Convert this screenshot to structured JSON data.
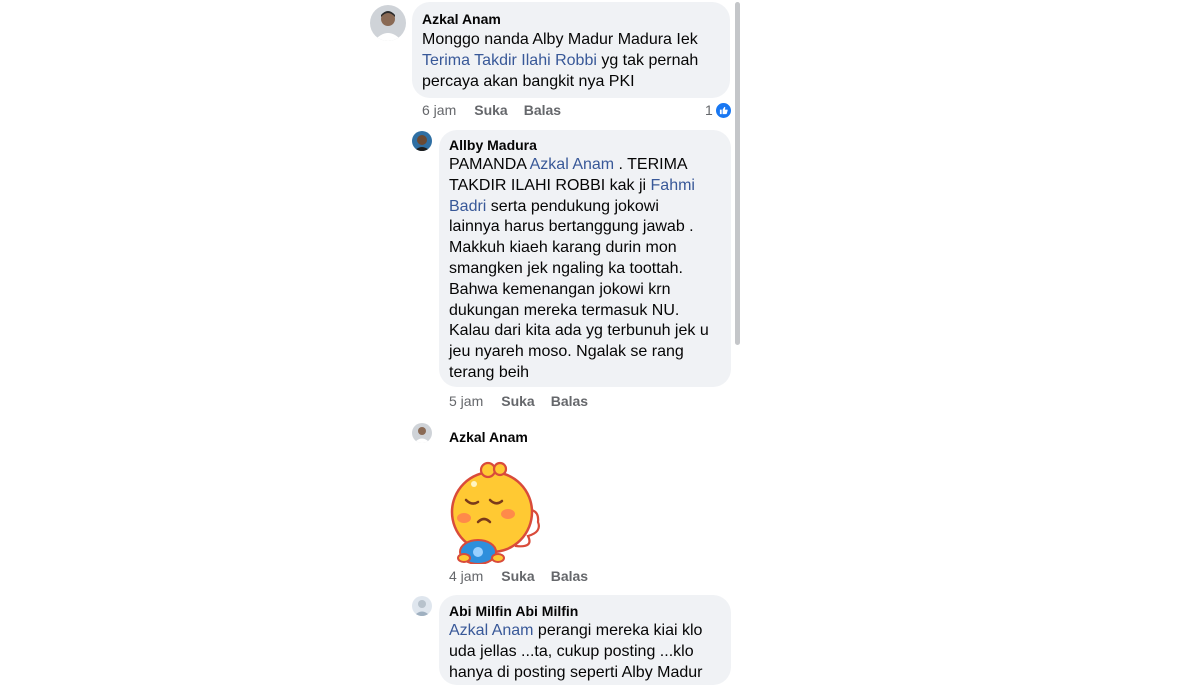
{
  "comments": [
    {
      "author": "Azkal Anam",
      "lines": [
        [
          {
            "t": "Monggo nanda Alby Madur Madura  Iek",
            "m": false
          }
        ],
        [
          {
            "t": "Terima Takdir Ilahi Robbi",
            "m": true
          },
          {
            "t": " yg tak pernah",
            "m": false
          }
        ],
        [
          {
            "t": "percaya akan bangkit nya PKI",
            "m": false
          }
        ]
      ],
      "time": "6 jam",
      "like": "Suka",
      "reply": "Balas",
      "reactions": "1"
    },
    {
      "author": "Allby Madura",
      "lines": [
        [
          {
            "t": "PAMANDA ",
            "m": false
          },
          {
            "t": "Azkal Anam",
            "m": true
          },
          {
            "t": " . TERIMA",
            "m": false
          }
        ],
        [
          {
            "t": "TAKDIR ILAHI ROBBI kak ji ",
            "m": false
          },
          {
            "t": "Fahmi",
            "m": true
          }
        ],
        [
          {
            "t": "Badri",
            "m": true
          },
          {
            "t": " serta pendukung jokowi",
            "m": false
          }
        ],
        [
          {
            "t": "lainnya harus bertanggung jawab .",
            "m": false
          }
        ],
        [
          {
            "t": "Makkuh kiaeh karang durin mon",
            "m": false
          }
        ],
        [
          {
            "t": "smangken jek ngaling ka toottah.",
            "m": false
          }
        ],
        [
          {
            "t": "Bahwa kemenangan jokowi krn",
            "m": false
          }
        ],
        [
          {
            "t": "dukungan mereka termasuk NU.",
            "m": false
          }
        ],
        [
          {
            "t": "Kalau dari kita ada yg terbunuh jek u",
            "m": false
          }
        ],
        [
          {
            "t": "jeu nyareh moso. Ngalak se rang",
            "m": false
          }
        ],
        [
          {
            "t": "terang beih",
            "m": false
          }
        ]
      ],
      "time": "5 jam",
      "like": "Suka",
      "reply": "Balas"
    },
    {
      "author": "Azkal Anam",
      "sticker": "crying-angel-sticker",
      "time": "4 jam",
      "like": "Suka",
      "reply": "Balas"
    },
    {
      "author": "Abi Milfin Abi Milfin",
      "lines": [
        [
          {
            "t": "Azkal Anam",
            "m": true
          },
          {
            "t": " perangi mereka kiai klo",
            "m": false
          }
        ],
        [
          {
            "t": "uda jellas ...ta, cukup posting ...klo",
            "m": false
          }
        ],
        [
          {
            "t": "hanya di posting seperti Alby Madur",
            "m": false
          }
        ]
      ]
    }
  ],
  "colors": {
    "mention": "#385898",
    "meta": "#65676b",
    "bubble": "#f0f2f5",
    "like": "#1877f2"
  }
}
